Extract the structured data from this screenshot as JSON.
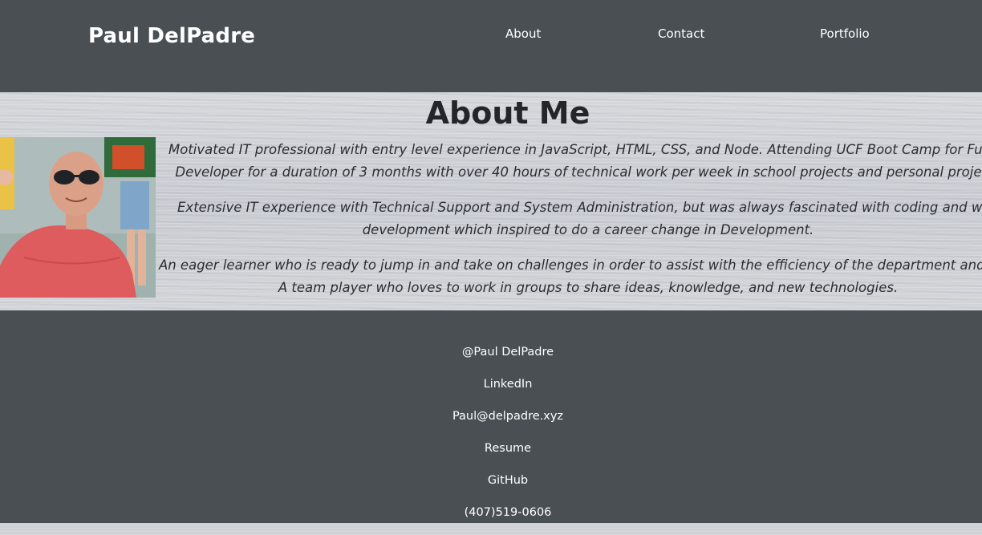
{
  "header": {
    "brand": "Paul DelPadre",
    "nav": {
      "about": "About",
      "contact": "Contact",
      "portfolio": "Portfolio"
    }
  },
  "about": {
    "title": "About Me",
    "paragraphs": [
      {
        "line1": "Motivated IT professional with entry level experience in JavaScript, HTML, CSS, and Node. Attending UCF Boot Camp for Full St",
        "line2": "Developer for a duration of 3 months with over 40 hours of technical work per week in school projects and personal projects"
      },
      {
        "line1": "Extensive IT experience with Technical Support and System Administration, but was always fascinated with coding and web",
        "line2": "development which inspired to do a career change in Development."
      },
      {
        "line1": "An eager learner who is ready to jump in and take on challenges in order to assist with the efficiency of the department and com",
        "line2": "A team player who loves to work in groups to share ideas, knowledge, and new technologies."
      }
    ]
  },
  "footer": {
    "handle": "@Paul DelPadre",
    "linkedin": "LinkedIn",
    "email": "Paul@delpadre.xyz",
    "resume": "Resume",
    "github": "GitHub",
    "phone": "(407)519-0606"
  }
}
